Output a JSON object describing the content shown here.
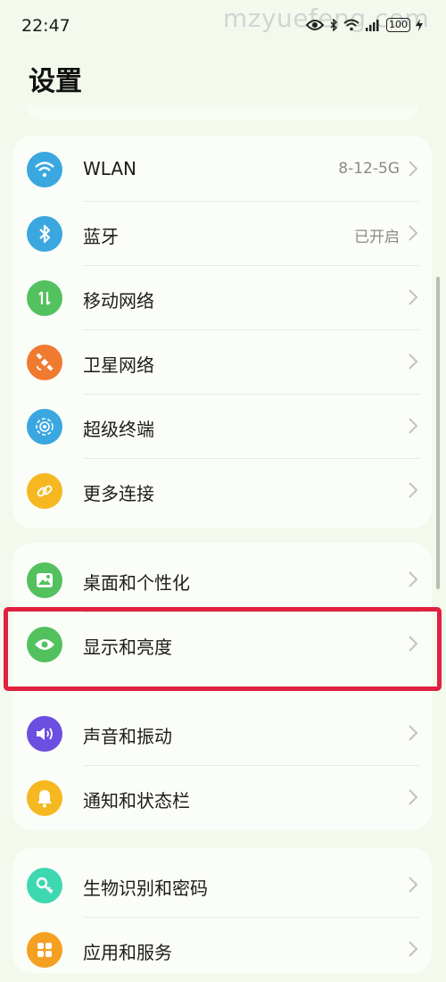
{
  "status_bar": {
    "time": "22:47",
    "watermark": "mzyuefeng.com",
    "battery": "100",
    "icons": [
      "eye-icon",
      "bluetooth-icon",
      "wifi-icon",
      "signal-icon",
      "battery-icon",
      "charging-icon"
    ]
  },
  "page": {
    "title": "设置"
  },
  "groups": [
    {
      "items": [
        {
          "label": "WLAN",
          "value": "8-12-5G",
          "icon": "wifi-icon",
          "color": "#3aa7e0"
        },
        {
          "label": "蓝牙",
          "value": "已开启",
          "icon": "bluetooth-icon",
          "color": "#3aa7e0"
        },
        {
          "label": "移动网络",
          "value": "",
          "icon": "mobile-data-icon",
          "color": "#52c15e"
        },
        {
          "label": "卫星网络",
          "value": "",
          "icon": "satellite-icon",
          "color": "#f07a30"
        },
        {
          "label": "超级终端",
          "value": "",
          "icon": "super-device-icon",
          "color": "#3aa7e0"
        },
        {
          "label": "更多连接",
          "value": "",
          "icon": "link-icon",
          "color": "#f5b820"
        }
      ]
    },
    {
      "items": [
        {
          "label": "桌面和个性化",
          "value": "",
          "icon": "wallpaper-icon",
          "color": "#52c15e"
        },
        {
          "label": "显示和亮度",
          "value": "",
          "icon": "eye-icon",
          "color": "#52c15e"
        },
        {
          "label": "声音和振动",
          "value": "",
          "icon": "speaker-icon",
          "color": "#6a4fe0"
        },
        {
          "label": "通知和状态栏",
          "value": "",
          "icon": "bell-icon",
          "color": "#f5b820"
        }
      ]
    },
    {
      "items": [
        {
          "label": "生物识别和密码",
          "value": "",
          "icon": "key-icon",
          "color": "#3ed8b0"
        },
        {
          "label": "应用和服务",
          "value": "",
          "icon": "apps-grid-icon",
          "color": "#f5a020"
        }
      ]
    }
  ],
  "highlight": {
    "target": "显示和亮度",
    "color": "#e0213f"
  }
}
